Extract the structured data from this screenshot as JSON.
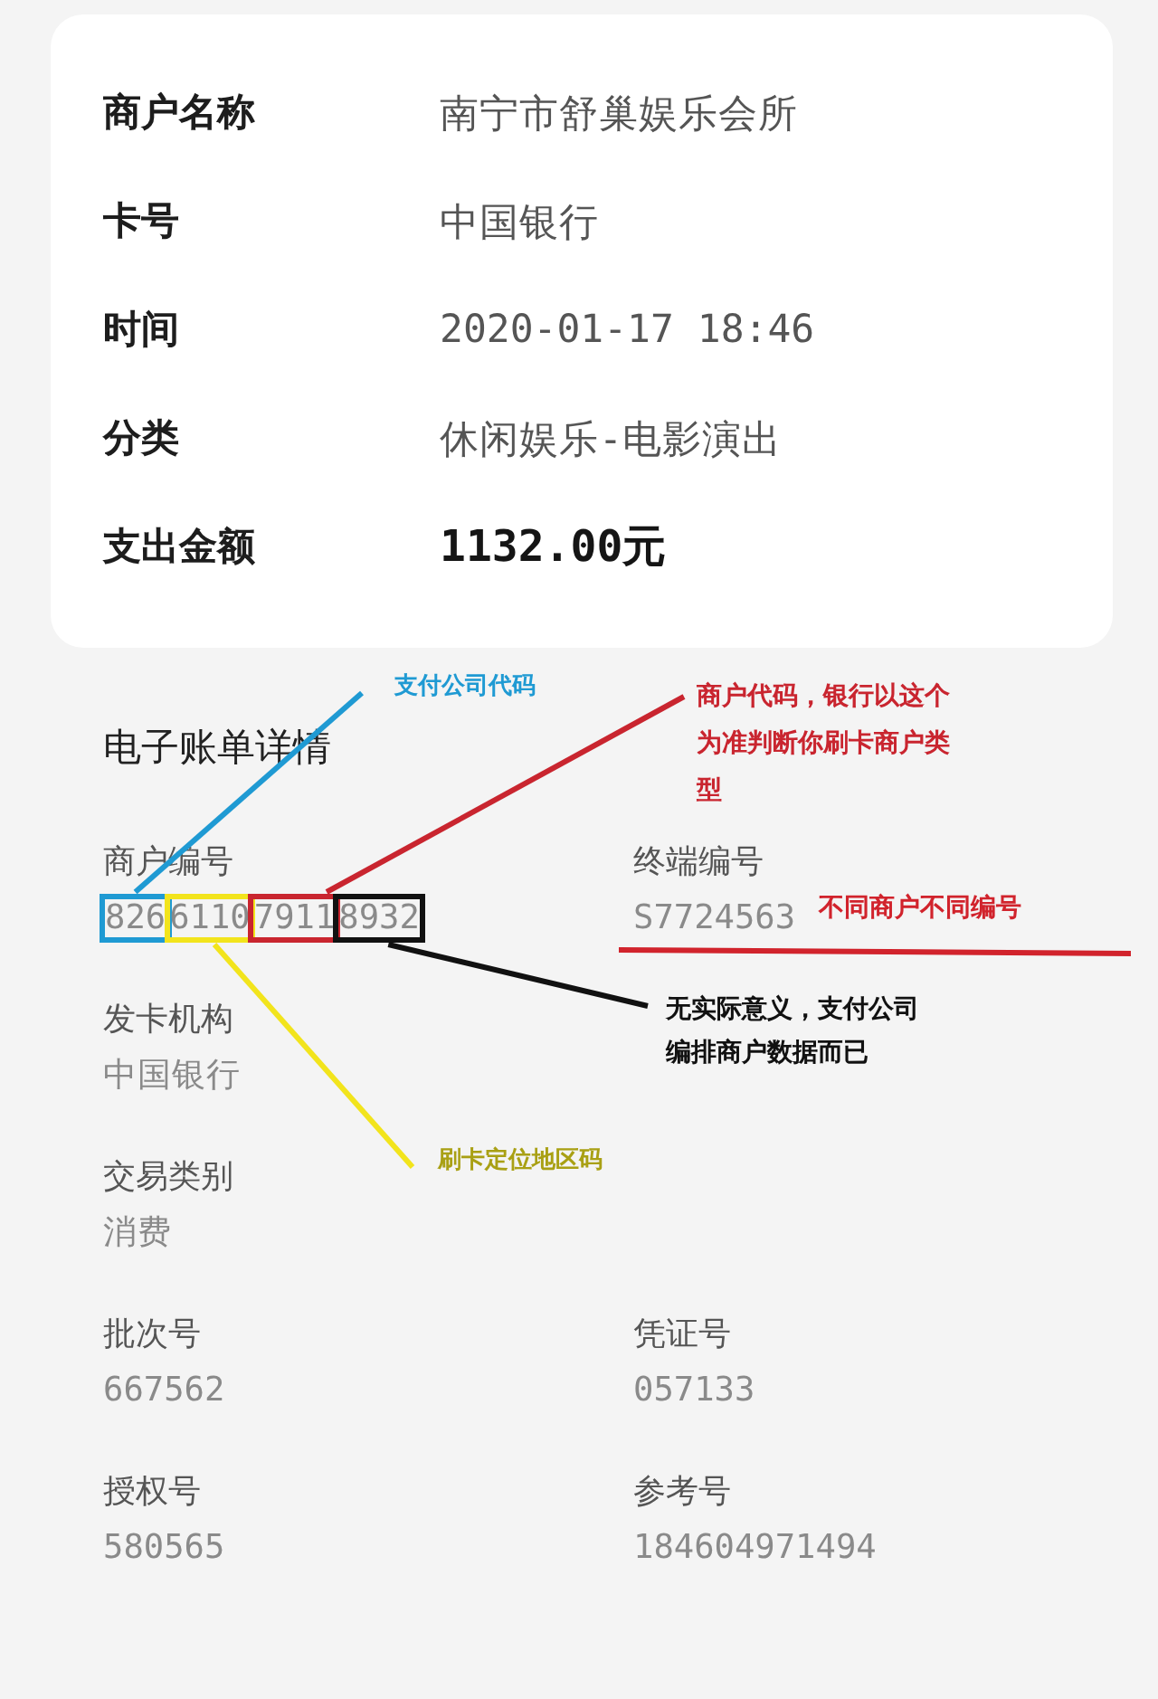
{
  "summary": {
    "rows": [
      {
        "label": "商户名称",
        "value": "南宁市舒巢娱乐会所",
        "kind": "text"
      },
      {
        "label": "卡号",
        "value": "中国银行",
        "kind": "text"
      },
      {
        "label": "时间",
        "value": "2020-01-17 18:46",
        "kind": "text"
      },
      {
        "label": "分类",
        "value": "休闲娱乐-电影演出",
        "kind": "text"
      },
      {
        "label": "支出金额",
        "value": "1132.00元",
        "kind": "amount"
      }
    ]
  },
  "details": {
    "title": "电子账单详情",
    "rows": [
      {
        "cells": [
          {
            "label": "商户编号",
            "segments": [
              {
                "digits": "826",
                "note": "支付公司代码",
                "color": "#1f9ad3"
              },
              {
                "digits": "6110",
                "note": "刷卡定位地区码",
                "color": "#f2e41c"
              },
              {
                "digits": "7911",
                "note": "商户代码，银行以这个为准判断你刷卡商户类型",
                "color": "#c9252f"
              },
              {
                "digits": "8932",
                "note": "无实际意义，支付公司编排商户数据而已",
                "color": "#111111"
              }
            ]
          },
          {
            "label": "终端编号",
            "value": "S7724563",
            "note": "不同商户不同编号"
          }
        ]
      },
      {
        "cells": [
          {
            "label": "发卡机构",
            "value": "中国银行"
          }
        ]
      },
      {
        "cells": [
          {
            "label": "交易类别",
            "value": "消费"
          }
        ]
      },
      {
        "cells": [
          {
            "label": "批次号",
            "value": "667562"
          },
          {
            "label": "凭证号",
            "value": "057133"
          }
        ]
      },
      {
        "cells": [
          {
            "label": "授权号",
            "value": "580565"
          },
          {
            "label": "参考号",
            "value": "184604971494"
          }
        ]
      }
    ]
  }
}
